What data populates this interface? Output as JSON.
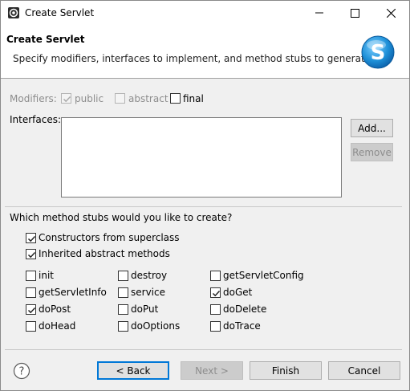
{
  "window": {
    "title": "Create Servlet"
  },
  "banner": {
    "title": "Create Servlet",
    "description": "Specify modifiers, interfaces to implement, and method stubs to generate.",
    "logo_letter": "S"
  },
  "modifiers": {
    "label": "Modifiers:",
    "public": {
      "label": "public",
      "checked": true,
      "enabled": false
    },
    "abstract": {
      "label": "abstract",
      "checked": false,
      "enabled": false
    },
    "final": {
      "label": "final",
      "checked": false,
      "enabled": true
    }
  },
  "interfaces": {
    "label": "Interfaces:",
    "add_label": "Add...",
    "remove_label": "Remove"
  },
  "stubs": {
    "question": "Which method stubs would you like to create?",
    "constructors": {
      "label": "Constructors from superclass",
      "checked": true
    },
    "inherited": {
      "label": "Inherited abstract methods",
      "checked": true
    },
    "methods": [
      {
        "label": "init",
        "checked": false
      },
      {
        "label": "destroy",
        "checked": false
      },
      {
        "label": "getServletConfig",
        "checked": false
      },
      {
        "label": "getServletInfo",
        "checked": false
      },
      {
        "label": "service",
        "checked": false
      },
      {
        "label": "doGet",
        "checked": true
      },
      {
        "label": "doPost",
        "checked": true
      },
      {
        "label": "doPut",
        "checked": false
      },
      {
        "label": "doDelete",
        "checked": false
      },
      {
        "label": "doHead",
        "checked": false
      },
      {
        "label": "doOptions",
        "checked": false
      },
      {
        "label": "doTrace",
        "checked": false
      }
    ]
  },
  "footer": {
    "back_label": "< Back",
    "next_label": "Next >",
    "finish_label": "Finish",
    "cancel_label": "Cancel"
  },
  "colors": {
    "accent": "#0078d7",
    "logo_blue": "#1e90d8"
  }
}
